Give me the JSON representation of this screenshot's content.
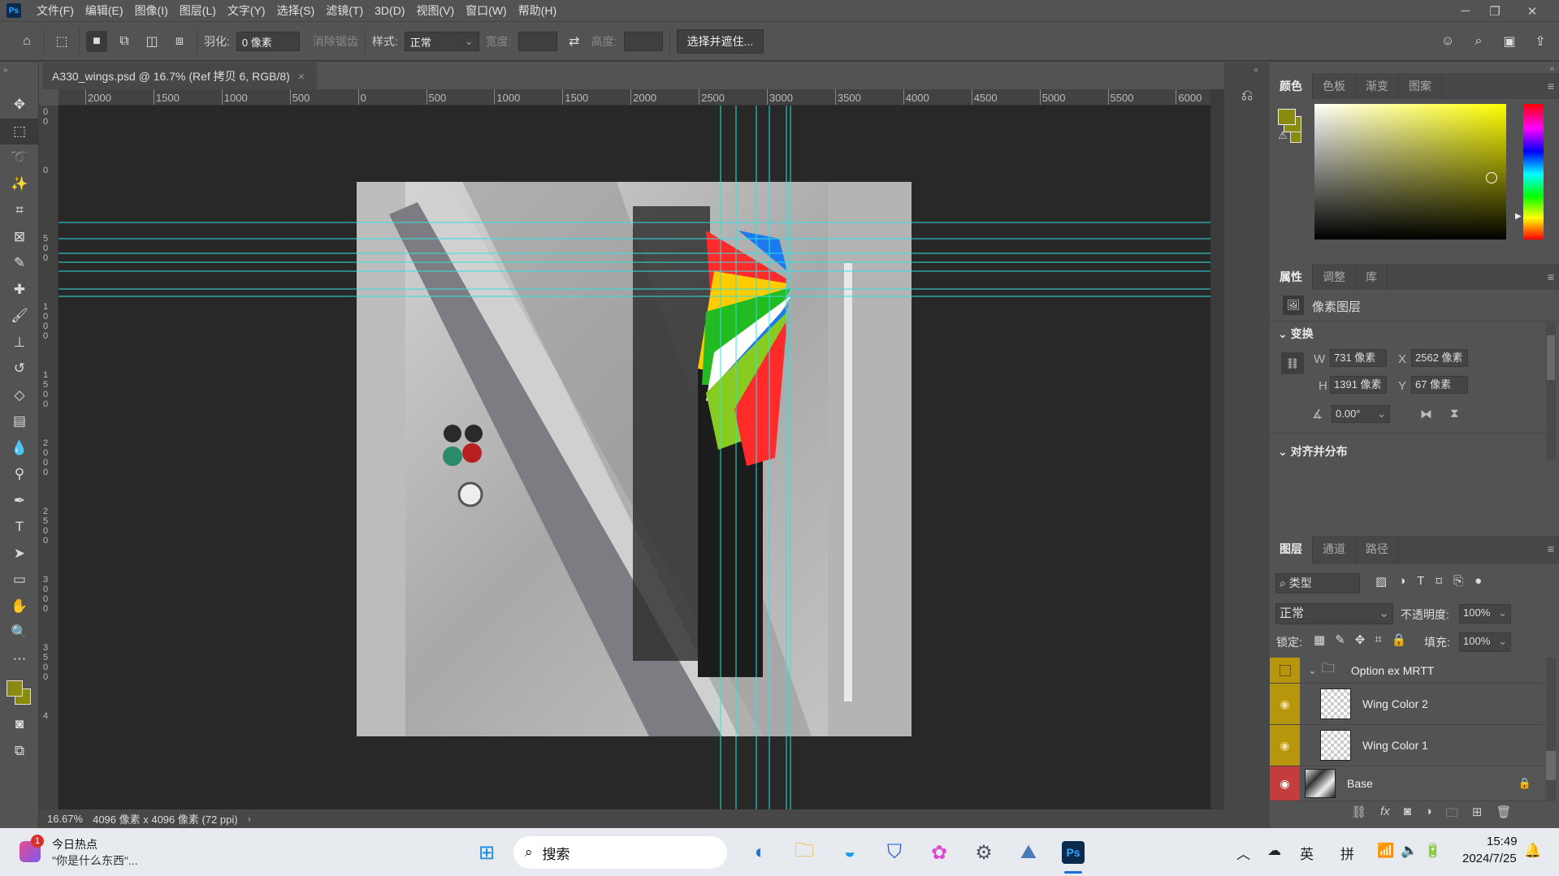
{
  "app": {
    "logo": "Ps",
    "menu": [
      "文件(F)",
      "编辑(E)",
      "图像(I)",
      "图层(L)",
      "文字(Y)",
      "选择(S)",
      "滤镜(T)",
      "3D(D)",
      "视图(V)",
      "窗口(W)",
      "帮助(H)"
    ]
  },
  "options": {
    "feather_label": "羽化:",
    "feather_value": "0 像素",
    "antialias": "消除锯齿",
    "style_label": "样式:",
    "style_value": "正常",
    "width_label": "宽度:",
    "height_label": "高度:",
    "select_mask": "选择并遮住..."
  },
  "document": {
    "tab_title": "A330_wings.psd @ 16.7% (Ref 拷贝 6, RGB/8)",
    "zoom": "16.67%",
    "info": "4096 像素 x 4096 像素 (72 ppi)"
  },
  "ruler": {
    "h_labels": [
      "2000",
      "1500",
      "1000",
      "500",
      "0",
      "500",
      "1000",
      "1500",
      "2000",
      "2500",
      "3000",
      "3500",
      "4000",
      "4500",
      "5000",
      "5500",
      "6000"
    ],
    "v_labels": [
      "500",
      "0",
      "500",
      "1000",
      "1500",
      "2000",
      "2500",
      "3000",
      "3500",
      "4"
    ]
  },
  "color_panel": {
    "tabs": [
      "颜色",
      "色板",
      "渐变",
      "图案"
    ],
    "foreground": "#8a8a10",
    "background": "#8a8a10",
    "hue": "#ffff00"
  },
  "properties": {
    "tabs": [
      "属性",
      "调整",
      "库"
    ],
    "layer_type": "像素图层",
    "transform_label": "变换",
    "w_label": "W",
    "w": "731 像素",
    "x_label": "X",
    "x": "2562 像素",
    "h_label": "H",
    "h": "1391 像素",
    "y_label": "Y",
    "y": "67 像素",
    "angle": "0.00°",
    "align_label": "对齐并分布"
  },
  "layers": {
    "tabs": [
      "图层",
      "通道",
      "路径"
    ],
    "filter": "类型",
    "blend": "正常",
    "opacity_label": "不透明度:",
    "opacity": "100%",
    "lock_label": "锁定:",
    "fill_label": "填充:",
    "fill": "100%",
    "items": [
      {
        "name": "Option ex MRTT",
        "type": "group",
        "color": "#b8960c"
      },
      {
        "name": "Wing Color 2",
        "color": "#b8960c"
      },
      {
        "name": "Wing Color 1",
        "color": "#b8960c"
      },
      {
        "name": "Base",
        "color": "#c43c3c"
      }
    ]
  },
  "taskbar": {
    "news_badge": "1",
    "news_title": "今日热点",
    "news_sub": "\"你是什么东西\"...",
    "search": "搜索",
    "ime1": "英",
    "ime2": "拼",
    "time": "15:49",
    "date": "2024/7/25"
  },
  "guide_color": "#33e0e0"
}
